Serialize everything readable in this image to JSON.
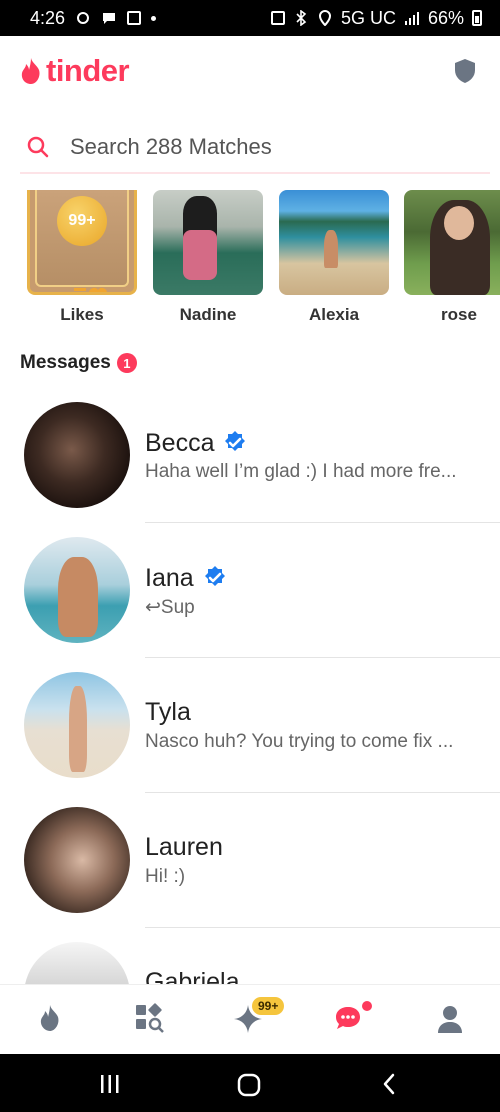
{
  "status_bar": {
    "time": "4:26",
    "network": "5G UC",
    "battery": "66%"
  },
  "header": {
    "logo_text": "tinder",
    "brand_color": "#fd3a5c"
  },
  "search": {
    "placeholder": "Search 288 Matches"
  },
  "matches": [
    {
      "name": "Likes",
      "badge": "99+"
    },
    {
      "name": "Nadine"
    },
    {
      "name": "Alexia"
    },
    {
      "name": "rose"
    }
  ],
  "messages": {
    "title": "Messages",
    "unread_count": "1",
    "items": [
      {
        "name": "Becca",
        "verified": true,
        "preview": "Haha well I’m glad :) I had more fre..."
      },
      {
        "name": "Iana",
        "verified": true,
        "preview": "Sup",
        "replied": true
      },
      {
        "name": "Tyla",
        "verified": false,
        "preview": "Nasco huh? You trying to come fix ..."
      },
      {
        "name": "Lauren",
        "verified": false,
        "preview": "Hi! :)"
      },
      {
        "name": "Gabriela",
        "verified": false,
        "preview": ""
      }
    ]
  },
  "bottom_nav": {
    "items": [
      "flame-icon",
      "explore-icon",
      "gold-home-icon",
      "chat-icon",
      "profile-icon"
    ],
    "gold_badge": "99+"
  }
}
